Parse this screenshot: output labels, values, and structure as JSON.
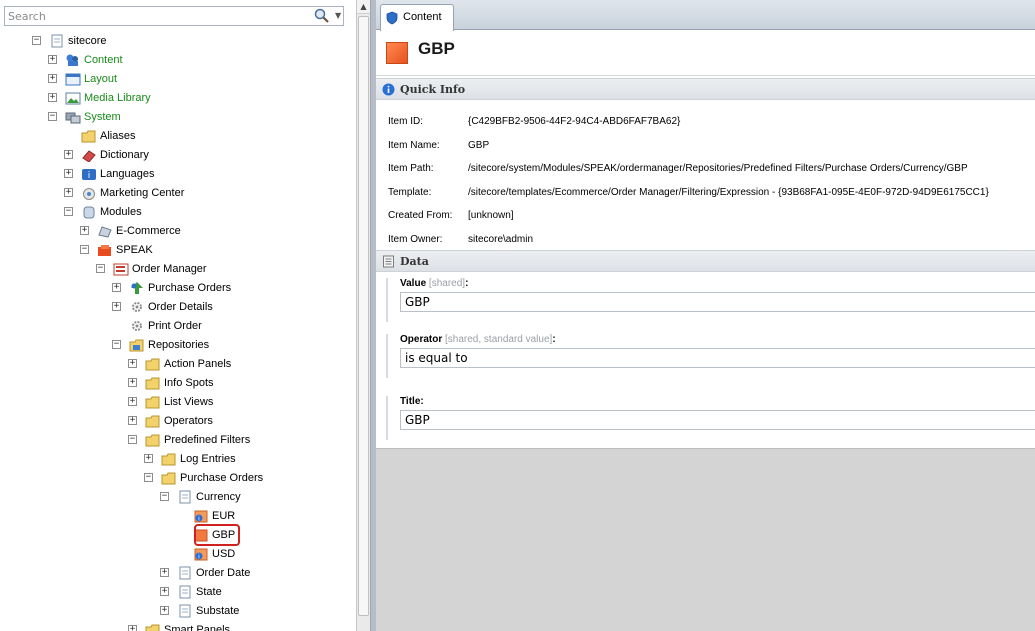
{
  "search": {
    "placeholder": "Search"
  },
  "tree": [
    {
      "label": "sitecore",
      "exp": "−",
      "icon": "page-icon",
      "color": "#000"
    },
    {
      "label": "Content",
      "exp": "+",
      "icon": "content-icon",
      "color": "#1a8a1a"
    },
    {
      "label": "Layout",
      "exp": "+",
      "icon": "layout-icon",
      "color": "#1a8a1a"
    },
    {
      "label": "Media Library",
      "exp": "+",
      "icon": "media-library-icon",
      "color": "#1a8a1a"
    },
    {
      "label": "System",
      "exp": "−",
      "icon": "system-icon",
      "color": "#1a8a1a"
    },
    {
      "label": "Aliases",
      "exp": "",
      "icon": "folder-icon",
      "color": "#000"
    },
    {
      "label": "Dictionary",
      "exp": "+",
      "icon": "dictionary-icon",
      "color": "#000"
    },
    {
      "label": "Languages",
      "exp": "+",
      "icon": "languages-icon",
      "color": "#000"
    },
    {
      "label": "Marketing Center",
      "exp": "+",
      "icon": "marketing-icon",
      "color": "#000"
    },
    {
      "label": "Modules",
      "exp": "−",
      "icon": "modules-icon",
      "color": "#000"
    },
    {
      "label": "E-Commerce",
      "exp": "+",
      "icon": "ecommerce-icon",
      "color": "#000"
    },
    {
      "label": "SPEAK",
      "exp": "−",
      "icon": "speak-icon",
      "color": "#000"
    },
    {
      "label": "Order Manager",
      "exp": "−",
      "icon": "order-manager-icon",
      "color": "#000"
    },
    {
      "label": "Purchase Orders",
      "exp": "+",
      "icon": "purchase-orders-icon",
      "color": "#000"
    },
    {
      "label": "Order Details",
      "exp": "+",
      "icon": "gear-icon",
      "color": "#000"
    },
    {
      "label": "Print Order",
      "exp": "",
      "icon": "gear-icon",
      "color": "#000"
    },
    {
      "label": "Repositories",
      "exp": "−",
      "icon": "repositories-icon",
      "color": "#000"
    },
    {
      "label": "Action Panels",
      "exp": "+",
      "icon": "folder-icon",
      "color": "#000"
    },
    {
      "label": "Info Spots",
      "exp": "+",
      "icon": "folder-icon",
      "color": "#000"
    },
    {
      "label": "List Views",
      "exp": "+",
      "icon": "folder-icon",
      "color": "#000"
    },
    {
      "label": "Operators",
      "exp": "+",
      "icon": "folder-icon",
      "color": "#000"
    },
    {
      "label": "Predefined Filters",
      "exp": "−",
      "icon": "folder-icon",
      "color": "#000"
    },
    {
      "label": "Log Entries",
      "exp": "+",
      "icon": "folder-icon",
      "color": "#000"
    },
    {
      "label": "Purchase Orders",
      "exp": "−",
      "icon": "folder-icon",
      "color": "#000"
    },
    {
      "label": "Currency",
      "exp": "−",
      "icon": "page-icon",
      "color": "#000"
    },
    {
      "label": "EUR",
      "exp": "",
      "icon": "expression-icon",
      "color": "#000"
    },
    {
      "label": "GBP",
      "exp": "",
      "icon": "gbp-icon",
      "color": "#000"
    },
    {
      "label": "USD",
      "exp": "",
      "icon": "expression-icon",
      "color": "#000"
    },
    {
      "label": "Order Date",
      "exp": "+",
      "icon": "page-icon",
      "color": "#000"
    },
    {
      "label": "State",
      "exp": "+",
      "icon": "page-icon",
      "color": "#000"
    },
    {
      "label": "Substate",
      "exp": "+",
      "icon": "page-icon",
      "color": "#000"
    },
    {
      "label": "Smart Panels",
      "exp": "+",
      "icon": "folder-icon",
      "color": "#000"
    }
  ],
  "tab": {
    "label": "Content"
  },
  "header": {
    "title": "GBP"
  },
  "quick_info": {
    "title": "Quick Info",
    "rows": [
      {
        "key": "Item ID:",
        "value": "{C429BFB2-9506-44F2-94C4-ABD6FAF7BA62}"
      },
      {
        "key": "Item Name:",
        "value": "GBP"
      },
      {
        "key": "Item Path:",
        "value": "/sitecore/system/Modules/SPEAK/ordermanager/Repositories/Predefined Filters/Purchase Orders/Currency/GBP"
      },
      {
        "key": "Template:",
        "value": "/sitecore/templates/Ecommerce/Order Manager/Filtering/Expression - {93B68FA1-095E-4E0F-972D-94D9E6175CC1}"
      },
      {
        "key": "Created From:",
        "value": "[unknown]"
      },
      {
        "key": "Item Owner:",
        "value": "sitecore\\admin"
      }
    ]
  },
  "data_section": {
    "title": "Data",
    "fields": [
      {
        "label": "Value",
        "meta": "[shared]",
        "value": "GBP"
      },
      {
        "label": "Operator",
        "meta": "[shared, standard value]",
        "value": "is equal to"
      },
      {
        "label": "Title",
        "meta": "",
        "value": "GBP"
      }
    ]
  },
  "colors": {
    "selection": "#d02020",
    "green_text": "#1a8a1a"
  }
}
